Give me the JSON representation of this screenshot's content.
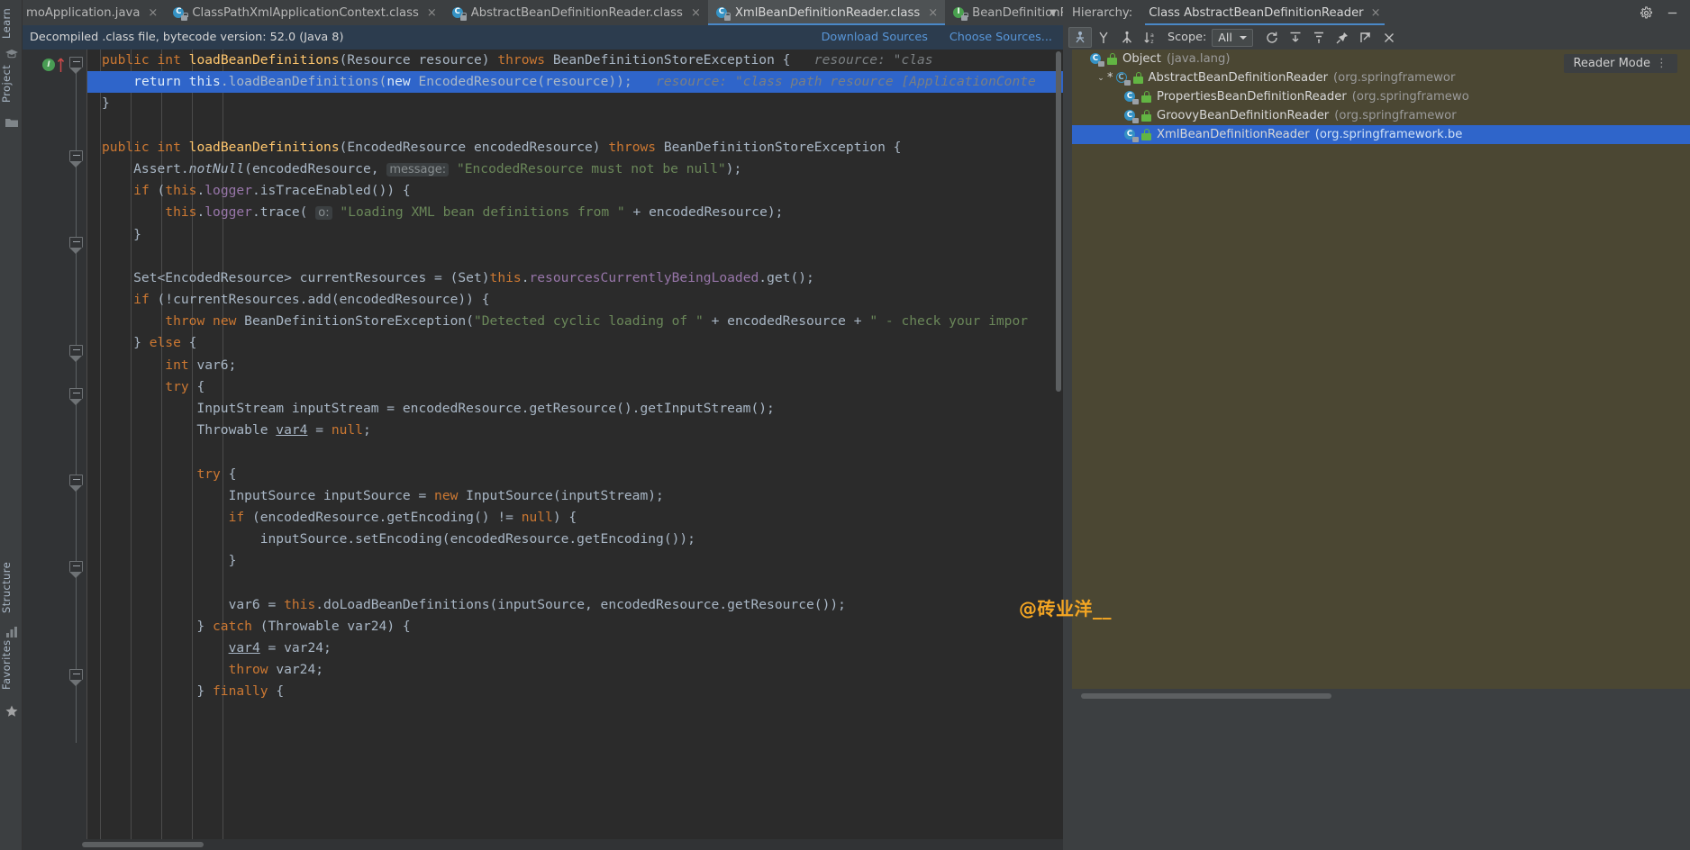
{
  "editor_tabs": [
    {
      "label": "moApplication.java",
      "icon": "java-file-icon",
      "active": false,
      "truncated": true
    },
    {
      "label": "ClassPathXmlApplicationContext.class",
      "icon": "class-icon",
      "active": false
    },
    {
      "label": "AbstractBeanDefinitionReader.class",
      "icon": "class-icon",
      "active": false
    },
    {
      "label": "XmlBeanDefinitionReader.class",
      "icon": "class-icon",
      "active": true
    },
    {
      "label": "BeanDefinitionReader.class",
      "icon": "interface-icon",
      "active": false
    }
  ],
  "notice": {
    "text": "Decompiled .class file, bytecode version: 52.0 (Java 8)",
    "download_sources": "Download Sources",
    "choose_sources": "Choose Sources..."
  },
  "reader_mode": {
    "label": "Reader Mode",
    "dots": "⋮"
  },
  "watermark": {
    "text": "@砖业洋__",
    "color": "#f5a623"
  },
  "left_tool_window": {
    "learn": "Learn",
    "project": "Project",
    "structure": "Structure",
    "favorites": "Favorites"
  },
  "hierarchy": {
    "title": "Hierarchy:",
    "tab_label": "Class AbstractBeanDefinitionReader",
    "tab_close": "×",
    "gear": "⚙",
    "minimize": "─",
    "toolbar": {
      "scope_label": "Scope:",
      "scope_value": "All",
      "buttons": [
        "subtypes-hierarchy-icon",
        "supertypes-hierarchy-icon",
        "subtypes-and-supertypes-icon",
        "sort-alphabetically-icon",
        "refresh-icon",
        "export-icon",
        "expand-collapse-icon",
        "pin-icon",
        "open-in-new-window-icon",
        "close-icon"
      ]
    },
    "tree": [
      {
        "name": "Object",
        "pkg": "(java.lang)",
        "indent": 0,
        "icon": "class-icon",
        "twisty": "",
        "abstract": false,
        "selected": false
      },
      {
        "name": "AbstractBeanDefinitionReader",
        "pkg": "(org.springframewor",
        "indent": 1,
        "icon": "class-icon",
        "twisty": "⌄",
        "abstract": true,
        "star": "*",
        "selected": false
      },
      {
        "name": "PropertiesBeanDefinitionReader",
        "pkg": "(org.springframewo",
        "indent": 2,
        "icon": "class-icon",
        "twisty": "",
        "abstract": false,
        "selected": false
      },
      {
        "name": "GroovyBeanDefinitionReader",
        "pkg": "(org.springframewor",
        "indent": 2,
        "icon": "class-icon",
        "twisty": "",
        "abstract": false,
        "selected": false
      },
      {
        "name": "XmlBeanDefinitionReader",
        "pkg": "(org.springframework.be",
        "indent": 2,
        "icon": "class-icon",
        "twisty": "",
        "abstract": false,
        "selected": true
      }
    ]
  },
  "code": {
    "lines": [
      {
        "i": 0,
        "sel": false,
        "html": "<span class=\"kw\">public</span> <span class=\"kw\">int</span> <span class=\"fn\">loadBeanDefinitions</span>(Resource resource) <span class=\"kw\">throws</span> BeanDefinitionStoreException {",
        "inlay": "resource: \"clas"
      },
      {
        "i": 1,
        "sel": true,
        "html": "    <span class=\"kw\">return</span> <span class=\"kw\">this</span>.loadBeanDefinitions(<span class=\"kw\">new</span> EncodedResource(resource));",
        "inlay": "resource: \"class path resource [ApplicationConte"
      },
      {
        "i": 2,
        "sel": false,
        "html": "}"
      },
      {
        "i": 3,
        "sel": false,
        "html": ""
      },
      {
        "i": 4,
        "sel": false,
        "html": "<span class=\"kw\">public</span> <span class=\"kw\">int</span> <span class=\"fn\">loadBeanDefinitions</span>(EncodedResource encodedResource) <span class=\"kw\">throws</span> BeanDefinitionStoreException {"
      },
      {
        "i": 5,
        "sel": false,
        "html": "    Assert.<span class=\"ital\">notNull</span>(encodedResource, <span class=\"hint\">message:</span> <span class=\"str\">\"EncodedResource must not be null\"</span>);"
      },
      {
        "i": 6,
        "sel": false,
        "html": "    <span class=\"kw\">if</span> (<span class=\"kw\">this</span>.<span class=\"fld\">logger</span>.isTraceEnabled()) {"
      },
      {
        "i": 7,
        "sel": false,
        "html": "        <span class=\"kw\">this</span>.<span class=\"fld\">logger</span>.trace( <span class=\"hint\">o:</span> <span class=\"str\">\"Loading XML bean definitions from \"</span> + encodedResource);"
      },
      {
        "i": 8,
        "sel": false,
        "html": "    }"
      },
      {
        "i": 9,
        "sel": false,
        "html": ""
      },
      {
        "i": 10,
        "sel": false,
        "html": "    Set&lt;EncodedResource&gt; currentResources = (Set)<span class=\"kw\">this</span>.<span class=\"fld\">resourcesCurrentlyBeingLoaded</span>.get();"
      },
      {
        "i": 11,
        "sel": false,
        "html": "    <span class=\"kw\">if</span> (!currentResources.add(encodedResource)) {"
      },
      {
        "i": 12,
        "sel": false,
        "html": "        <span class=\"kw\">throw</span> <span class=\"kw\">new</span> BeanDefinitionStoreException(<span class=\"str\">\"Detected cyclic loading of \"</span> + encodedResource + <span class=\"str\">\" - check your impor</span>"
      },
      {
        "i": 13,
        "sel": false,
        "html": "    } <span class=\"kw\">else</span> {"
      },
      {
        "i": 14,
        "sel": false,
        "html": "        <span class=\"kw\">int</span> var6;"
      },
      {
        "i": 15,
        "sel": false,
        "html": "        <span class=\"kw\">try</span> {"
      },
      {
        "i": 16,
        "sel": false,
        "html": "            InputStream inputStream = encodedResource.getResource().getInputStream();"
      },
      {
        "i": 17,
        "sel": false,
        "html": "            Throwable <span class=\"und\">var4</span> = <span class=\"kw\">null</span>;"
      },
      {
        "i": 18,
        "sel": false,
        "html": ""
      },
      {
        "i": 19,
        "sel": false,
        "html": "            <span class=\"kw\">try</span> {"
      },
      {
        "i": 20,
        "sel": false,
        "html": "                InputSource inputSource = <span class=\"kw\">new</span> InputSource(inputStream);"
      },
      {
        "i": 21,
        "sel": false,
        "html": "                <span class=\"kw\">if</span> (encodedResource.getEncoding() != <span class=\"kw\">null</span>) {"
      },
      {
        "i": 22,
        "sel": false,
        "html": "                    inputSource.setEncoding(encodedResource.getEncoding());"
      },
      {
        "i": 23,
        "sel": false,
        "html": "                }"
      },
      {
        "i": 24,
        "sel": false,
        "html": ""
      },
      {
        "i": 25,
        "sel": false,
        "html": "                var6 = <span class=\"kw\">this</span>.doLoadBeanDefinitions(inputSource, encodedResource.getResource());"
      },
      {
        "i": 26,
        "sel": false,
        "html": "            } <span class=\"kw\">catch</span> (Throwable var24) {"
      },
      {
        "i": 27,
        "sel": false,
        "html": "                <span class=\"und\">var4</span> = var24;"
      },
      {
        "i": 28,
        "sel": false,
        "html": "                <span class=\"kw\">throw</span> var24;"
      },
      {
        "i": 29,
        "sel": false,
        "html": "            } <span class=\"kw\">finally</span> {"
      }
    ]
  }
}
